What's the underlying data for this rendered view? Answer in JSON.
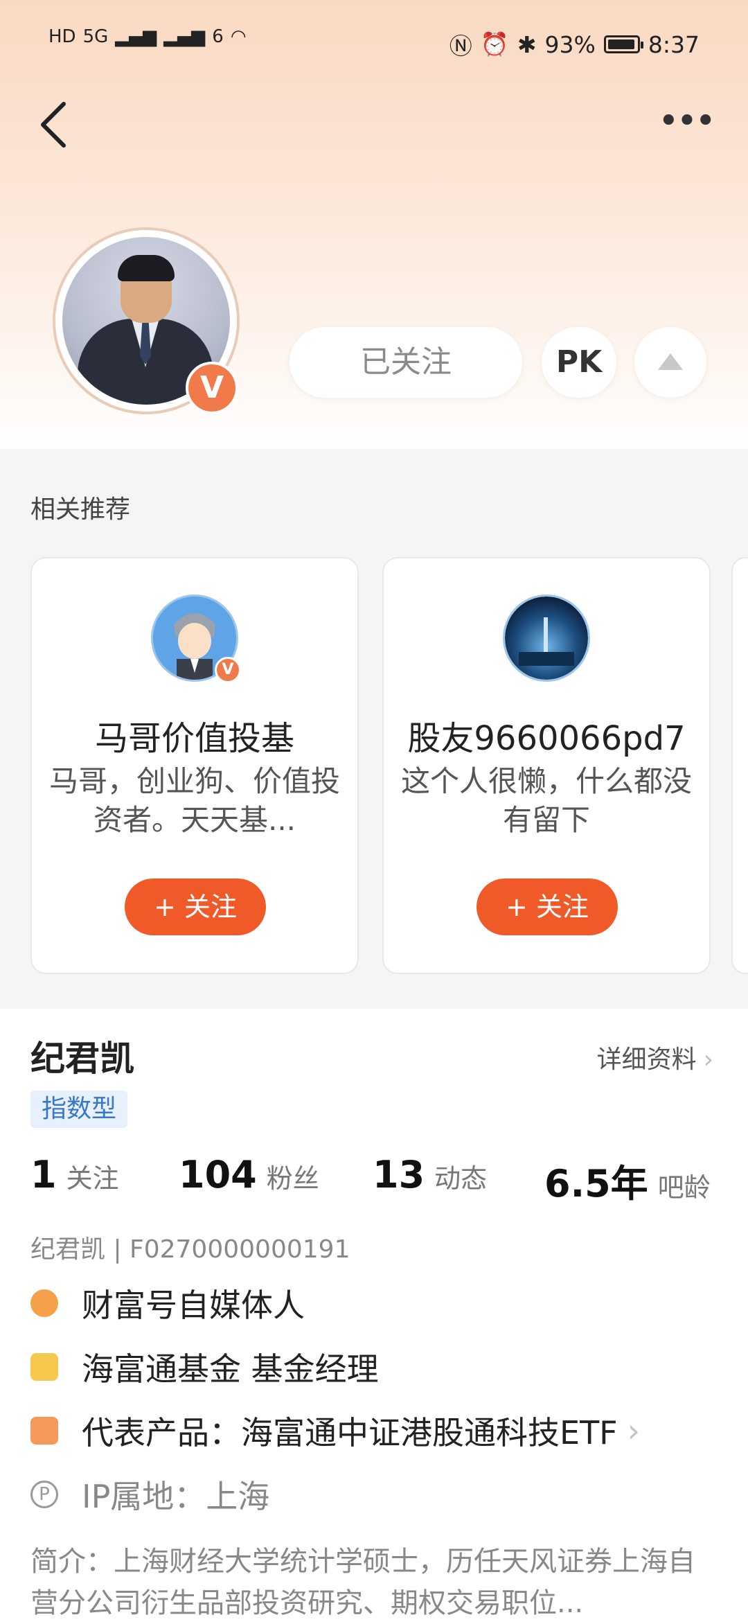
{
  "status_bar": {
    "left_icons": [
      "HD",
      "5G",
      "signal-icon",
      "signal-icon",
      "6",
      "wifi-icon"
    ],
    "battery": "93%",
    "time": "8:37"
  },
  "header": {
    "followed_label": "已关注",
    "pk_label": "PK",
    "verified_badge": "V"
  },
  "recommend": {
    "title": "相关推荐",
    "cards": [
      {
        "name": "马哥价值投基",
        "desc": "马哥，创业狗、价值投资者。天天基...",
        "follow": "+ 关注",
        "badge": "V"
      },
      {
        "name": "股友9660066pd7",
        "desc": "这个人很懒，什么都没有留下",
        "follow": "+ 关注"
      }
    ]
  },
  "profile": {
    "name": "纪君凯",
    "detail_link": "详细资料",
    "tag": "指数型",
    "stats": [
      {
        "num": "1",
        "label": "关注"
      },
      {
        "num": "104",
        "label": "粉丝"
      },
      {
        "num": "13",
        "label": "动态"
      },
      {
        "num": "6.5年",
        "label": "吧龄"
      }
    ],
    "uid_line": "纪君凯 | F0270000000191",
    "info": [
      {
        "icon": "medal-icon",
        "text": "财富号自媒体人"
      },
      {
        "icon": "crown-badge-icon",
        "text": "海富通基金 基金经理"
      },
      {
        "icon": "star-badge-icon",
        "text": "代表产品：海富通中证港股通科技ETF"
      },
      {
        "icon": "location-p-icon",
        "text": "IP属地：上海"
      }
    ],
    "intro": "简介：上海财经大学统计学硕士，历任天风证券上海自营分公司衍生品部投资研究、期权交易职位..."
  },
  "colors": {
    "accent": "#f05a28",
    "tag_bg": "#e7f0fb",
    "tag_text": "#3778c9"
  }
}
